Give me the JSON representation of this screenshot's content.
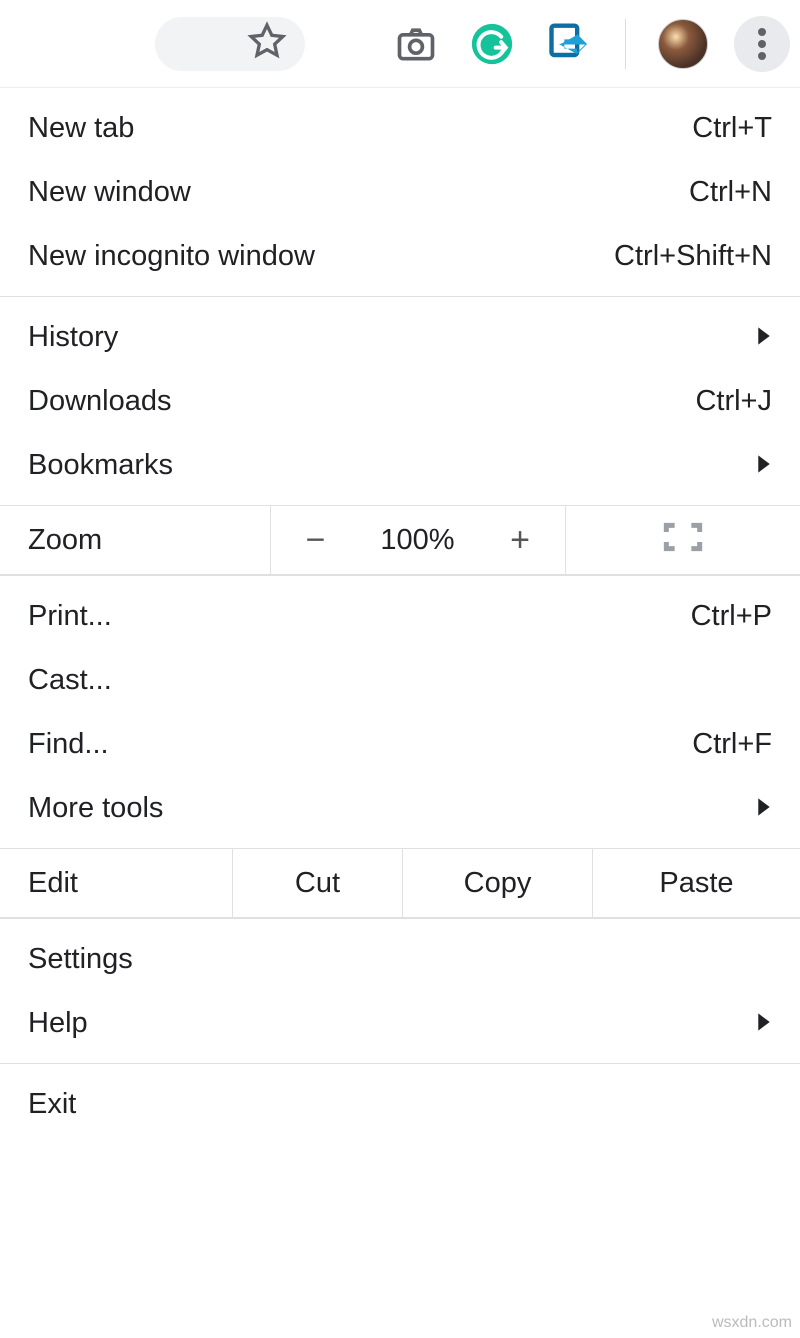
{
  "menu": {
    "new_tab": {
      "label": "New tab",
      "shortcut": "Ctrl+T"
    },
    "new_window": {
      "label": "New window",
      "shortcut": "Ctrl+N"
    },
    "new_incog": {
      "label": "New incognito window",
      "shortcut": "Ctrl+Shift+N"
    },
    "history": {
      "label": "History"
    },
    "downloads": {
      "label": "Downloads",
      "shortcut": "Ctrl+J"
    },
    "bookmarks": {
      "label": "Bookmarks"
    },
    "zoom": {
      "label": "Zoom",
      "minus": "−",
      "value": "100%",
      "plus": "+"
    },
    "print": {
      "label": "Print...",
      "shortcut": "Ctrl+P"
    },
    "cast": {
      "label": "Cast..."
    },
    "find": {
      "label": "Find...",
      "shortcut": "Ctrl+F"
    },
    "more_tools": {
      "label": "More tools"
    },
    "edit": {
      "label": "Edit",
      "cut": "Cut",
      "copy": "Copy",
      "paste": "Paste"
    },
    "settings": {
      "label": "Settings"
    },
    "help": {
      "label": "Help"
    },
    "exit": {
      "label": "Exit"
    }
  },
  "watermark": "wsxdn.com"
}
